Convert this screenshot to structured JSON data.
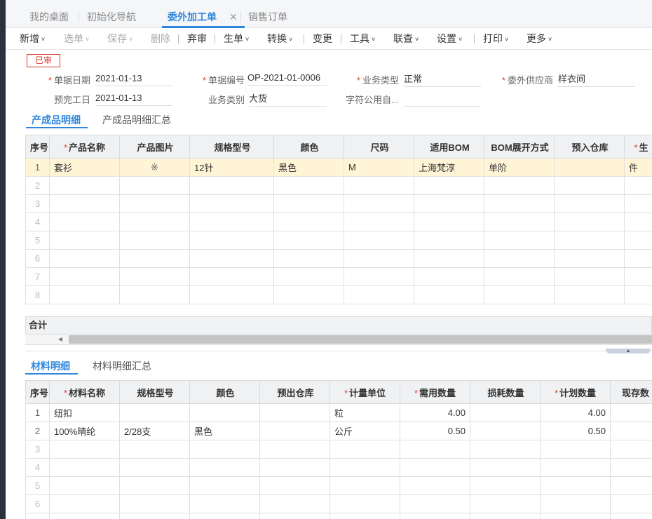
{
  "tabs": [
    {
      "label": "我的桌面"
    },
    {
      "label": "初始化导航"
    },
    {
      "label": "委外加工单"
    },
    {
      "label": "销售订单"
    }
  ],
  "tab_close_icon": "✕",
  "toolbar": [
    {
      "label": "新增",
      "caret": "˅"
    },
    {
      "label": "选单",
      "caret": "˅"
    },
    {
      "label": "保存",
      "caret": "˅"
    },
    {
      "label": "删除",
      "caret": ""
    },
    {
      "label": "弃审",
      "caret": ""
    },
    {
      "label": "生单",
      "caret": "˅"
    },
    {
      "label": "转换",
      "caret": "˅"
    },
    {
      "label": "变更",
      "caret": ""
    },
    {
      "label": "工具",
      "caret": "˅"
    },
    {
      "label": "联查",
      "caret": "˅"
    },
    {
      "label": "设置",
      "caret": "˅"
    },
    {
      "label": "打印",
      "caret": "˅"
    },
    {
      "label": "更多",
      "caret": "˅"
    }
  ],
  "status_badge": "已审",
  "form": {
    "doc_date": {
      "label": "单据日期",
      "value": "2021-01-13"
    },
    "doc_no": {
      "label": "单据编号",
      "value": "OP-2021-01-0006"
    },
    "biz_type": {
      "label": "业务类型",
      "value": "正常"
    },
    "supplier": {
      "label": "委外供应商",
      "value": "样衣间"
    },
    "finish_date": {
      "label": "预完工日",
      "value": "2021-01-13"
    },
    "biz_category": {
      "label": "业务类别",
      "value": "大货"
    },
    "public_char": {
      "label": "字符公用自...",
      "value": ""
    }
  },
  "product_tabs": [
    {
      "label": "产成品明细"
    },
    {
      "label": "产成品明细汇总"
    }
  ],
  "product_table": {
    "columns": [
      {
        "label": "序号",
        "required": ""
      },
      {
        "label": "产品名称",
        "required": "*"
      },
      {
        "label": "产品图片",
        "required": ""
      },
      {
        "label": "规格型号",
        "required": ""
      },
      {
        "label": "颜色",
        "required": ""
      },
      {
        "label": "尺码",
        "required": ""
      },
      {
        "label": "适用BOM",
        "required": ""
      },
      {
        "label": "BOM展开方式",
        "required": ""
      },
      {
        "label": "预入仓库",
        "required": ""
      },
      {
        "label": "生",
        "required": "*"
      }
    ],
    "rows": [
      [
        "1",
        "套衫",
        "※",
        "12针",
        "黑色",
        "M",
        "上海梵淳",
        "单阶",
        "",
        "件"
      ],
      [
        "2",
        "",
        "",
        "",
        "",
        "",
        "",
        "",
        "",
        ""
      ],
      [
        "3",
        "",
        "",
        "",
        "",
        "",
        "",
        "",
        "",
        ""
      ],
      [
        "4",
        "",
        "",
        "",
        "",
        "",
        "",
        "",
        "",
        ""
      ],
      [
        "5",
        "",
        "",
        "",
        "",
        "",
        "",
        "",
        "",
        ""
      ],
      [
        "6",
        "",
        "",
        "",
        "",
        "",
        "",
        "",
        "",
        ""
      ],
      [
        "7",
        "",
        "",
        "",
        "",
        "",
        "",
        "",
        "",
        ""
      ],
      [
        "8",
        "",
        "",
        "",
        "",
        "",
        "",
        "",
        "",
        ""
      ]
    ]
  },
  "sum_label": "合计",
  "material_tabs": [
    {
      "label": "材料明细"
    },
    {
      "label": "材料明细汇总"
    }
  ],
  "material_table": {
    "columns": [
      {
        "label": "序号",
        "required": ""
      },
      {
        "label": "材料名称",
        "required": "*"
      },
      {
        "label": "规格型号",
        "required": ""
      },
      {
        "label": "颜色",
        "required": ""
      },
      {
        "label": "预出仓库",
        "required": ""
      },
      {
        "label": "计量单位",
        "required": "*"
      },
      {
        "label": "需用数量",
        "required": "*"
      },
      {
        "label": "损耗数量",
        "required": ""
      },
      {
        "label": "计划数量",
        "required": "*"
      },
      {
        "label": "现存数",
        "required": ""
      }
    ],
    "rows": [
      [
        "1",
        "纽扣",
        "",
        "",
        "",
        "粒",
        "4.00",
        "",
        "4.00",
        ""
      ],
      [
        "2",
        "100%晴纶",
        "2/28支",
        "黑色",
        "",
        "公斤",
        "0.50",
        "",
        "0.50",
        ""
      ],
      [
        "3",
        "",
        "",
        "",
        "",
        "",
        "",
        "",
        "",
        ""
      ],
      [
        "4",
        "",
        "",
        "",
        "",
        "",
        "",
        "",
        "",
        ""
      ],
      [
        "5",
        "",
        "",
        "",
        "",
        "",
        "",
        "",
        "",
        ""
      ],
      [
        "6",
        "",
        "",
        "",
        "",
        "",
        "",
        "",
        "",
        ""
      ],
      [
        "7",
        "",
        "",
        "",
        "",
        "",
        "",
        "",
        "",
        ""
      ]
    ]
  },
  "scroll_left_icon": "◀",
  "collapse_icon": "▲"
}
